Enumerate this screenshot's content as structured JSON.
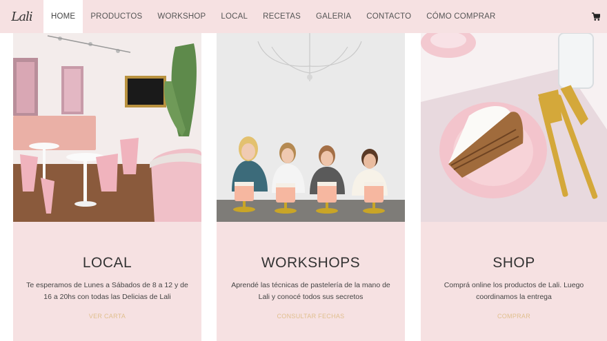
{
  "brand": {
    "logo_text": "Lali"
  },
  "nav": {
    "items": [
      {
        "label": "HOME",
        "active": true
      },
      {
        "label": "PRODUCTOS"
      },
      {
        "label": "WORKSHOP"
      },
      {
        "label": "LOCAL"
      },
      {
        "label": "RECETAS"
      },
      {
        "label": "GALERIA"
      },
      {
        "label": "CONTACTO"
      },
      {
        "label": "CÓMO COMPRAR"
      }
    ],
    "cart_icon": "shopping-cart-icon"
  },
  "cards": [
    {
      "title": "LOCAL",
      "description": "Te esperamos de Lunes a Sábados de 8 a 12 y de 16 a 20hs con todas las Delicias de Lali",
      "link": "VER CARTA",
      "image": "pink-cafe-interior-photo"
    },
    {
      "title": "WORKSHOPS",
      "description": "Aprendé las técnicas de pastelería de la mano de Lali y conocé todos sus secretos",
      "link": "CONSULTAR FECHAS",
      "image": "workshop-students-with-cakes-photo"
    },
    {
      "title": "SHOP",
      "description": "Comprá online los productos de Lali. Luego coordinamos la entrega",
      "link": "COMPRAR",
      "image": "cake-slice-on-pink-plate-photo"
    }
  ],
  "colors": {
    "nav_bg": "#f6e1e2",
    "card_bg": "#f6e1e2",
    "link": "#e0bf8e",
    "text": "#333333"
  }
}
